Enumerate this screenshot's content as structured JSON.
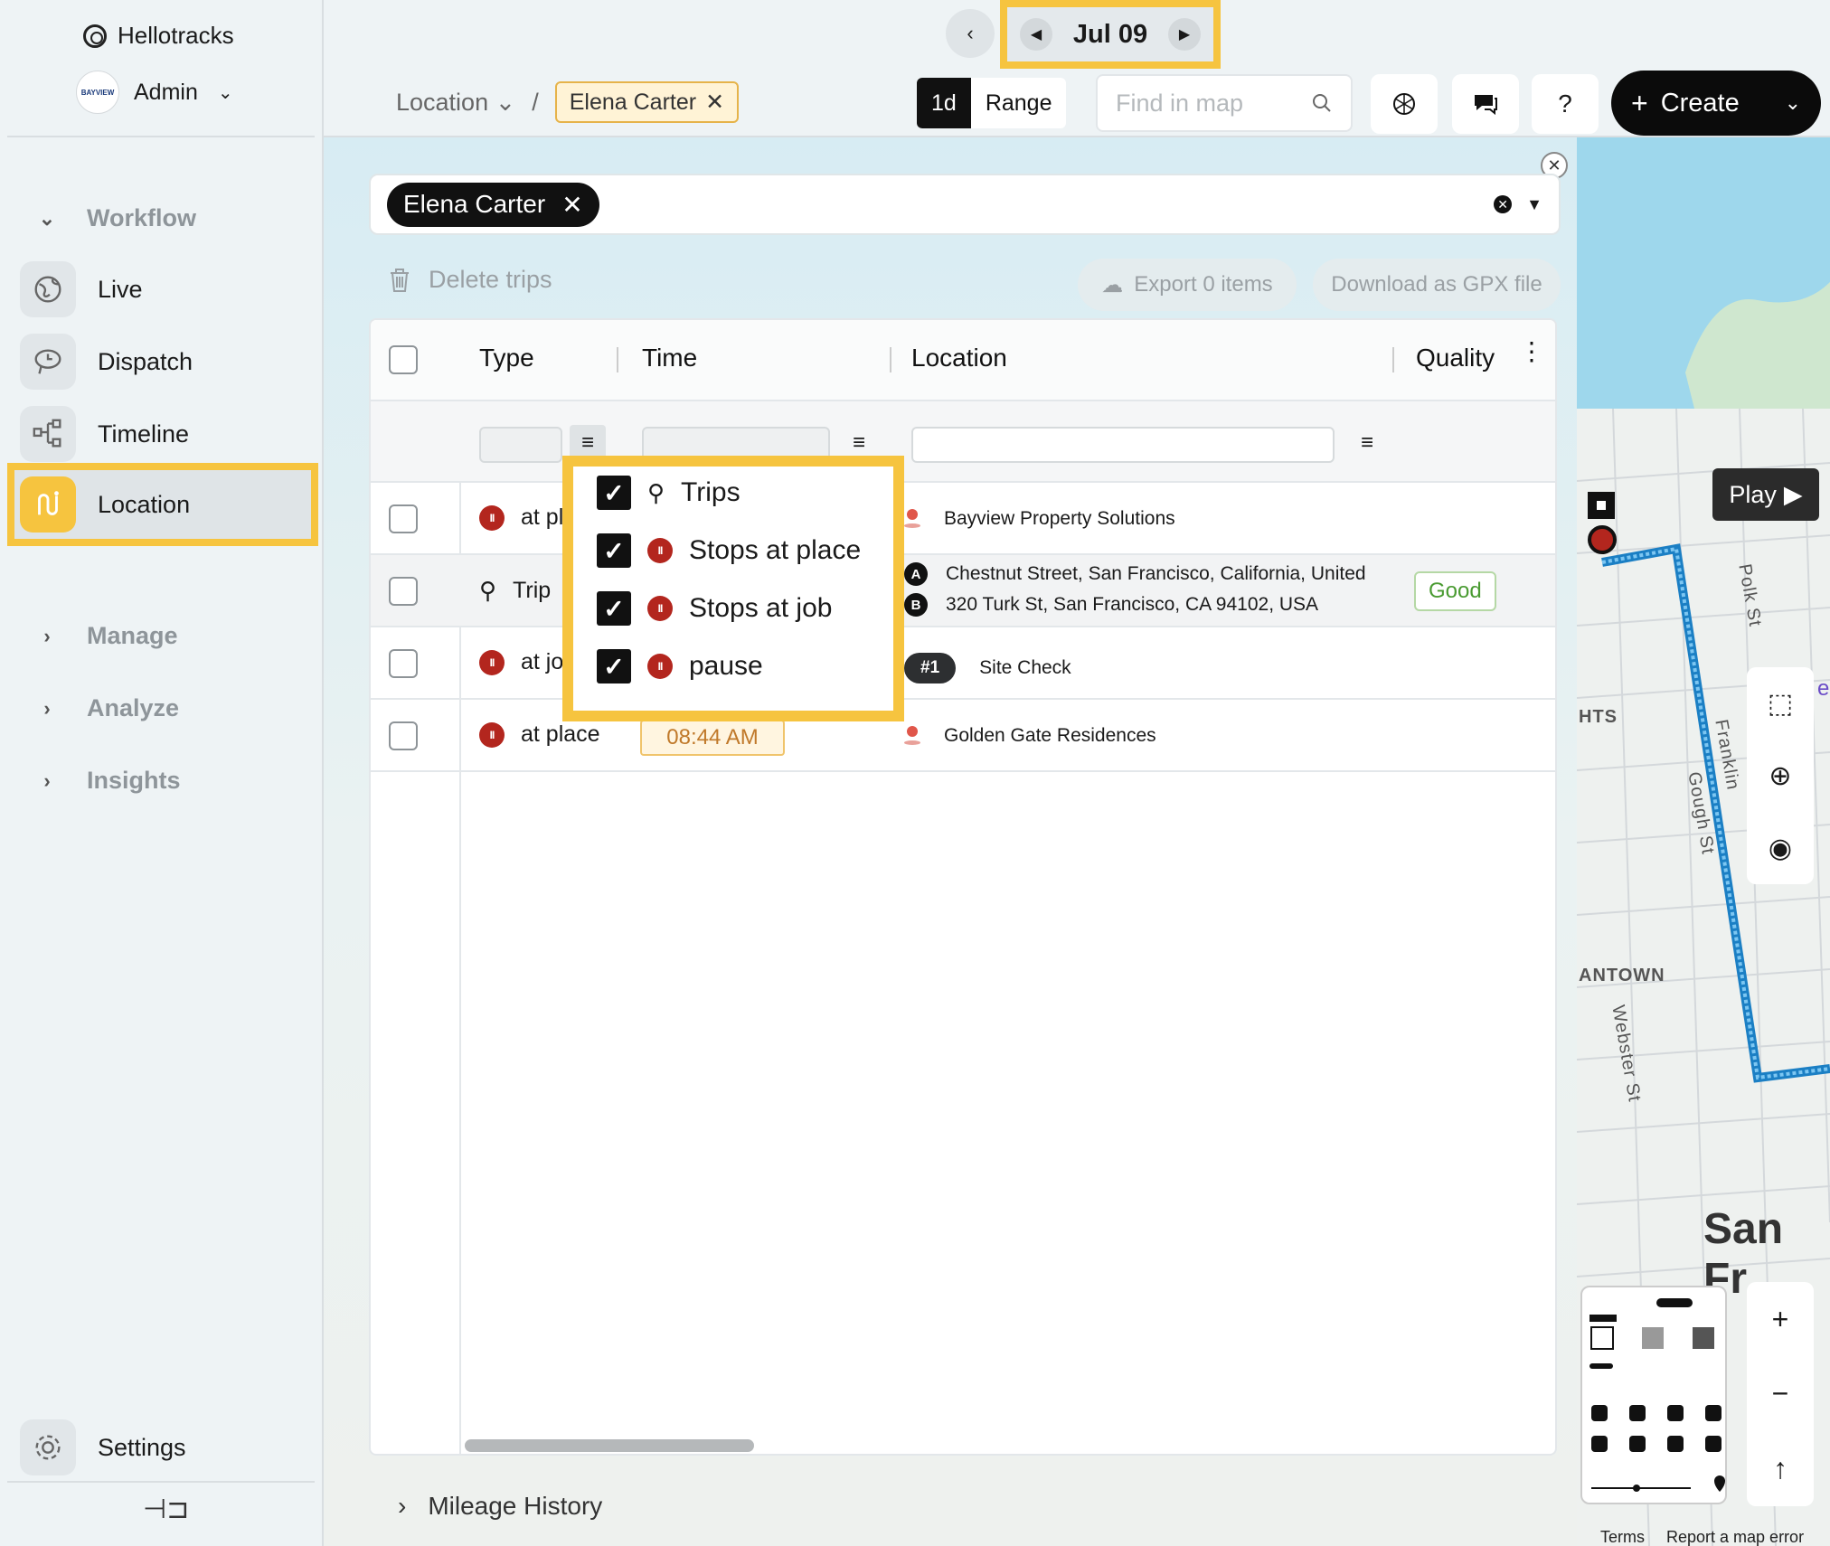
{
  "app": {
    "name": "Hellotracks",
    "account": "Admin",
    "avatar_text": "BAYVIEW"
  },
  "sidebar": {
    "groups": [
      {
        "label": "Workflow",
        "expanded": true
      },
      {
        "label": "Manage"
      },
      {
        "label": "Analyze"
      },
      {
        "label": "Insights"
      }
    ],
    "items": [
      {
        "label": "Live",
        "icon": "globe-icon"
      },
      {
        "label": "Dispatch",
        "icon": "dispatch-icon"
      },
      {
        "label": "Timeline",
        "icon": "timeline-icon"
      },
      {
        "label": "Location",
        "icon": "route-icon",
        "active": true
      }
    ],
    "settings": "Settings"
  },
  "topbar": {
    "date": "Jul 09",
    "breadcrumb": {
      "section": "Location",
      "separator": "/",
      "filter_chip": "Elena Carter"
    },
    "view_toggle": {
      "day": "1d",
      "range": "Range",
      "selected": "1d"
    },
    "search_placeholder": "Find in map",
    "help": "?",
    "create": "Create"
  },
  "panel": {
    "selected_person": "Elena Carter",
    "delete_trips": "Delete trips",
    "export": "Export 0 items",
    "download_gpx": "Download as GPX file",
    "columns": [
      "Type",
      "Time",
      "Location",
      "Quality"
    ],
    "rows": [
      {
        "type": "at pl",
        "location": "Bayview Property Solutions"
      },
      {
        "type": "Trip",
        "location_a": "Chestnut Street, San Francisco, California, United",
        "location_b": "320 Turk St, San Francisco, CA 94102, USA",
        "quality": "Good",
        "marker_a": "A",
        "marker_b": "B"
      },
      {
        "type": "at jo",
        "job_chip": "#1",
        "location": "Site Check"
      },
      {
        "type": "at place",
        "time": "08:44 AM",
        "location": "Golden Gate Residences"
      }
    ],
    "type_filter": [
      {
        "label": "Trips",
        "checked": true
      },
      {
        "label": "Stops at place",
        "checked": true
      },
      {
        "label": "Stops at job",
        "checked": true
      },
      {
        "label": "pause",
        "checked": true
      }
    ],
    "mileage_history": "Mileage History"
  },
  "map": {
    "play": "Play",
    "labels": [
      "HTS",
      "ANTOWN",
      "Polk St",
      "Webster St",
      "Gough St",
      "Franklin",
      "San Fr",
      "e"
    ],
    "footer": [
      "Terms",
      "Report a map error"
    ]
  },
  "colors": {
    "highlight": "#f6c43f",
    "stop": "#b3261e",
    "good": "#4a9b32",
    "route": "#2196f3"
  }
}
